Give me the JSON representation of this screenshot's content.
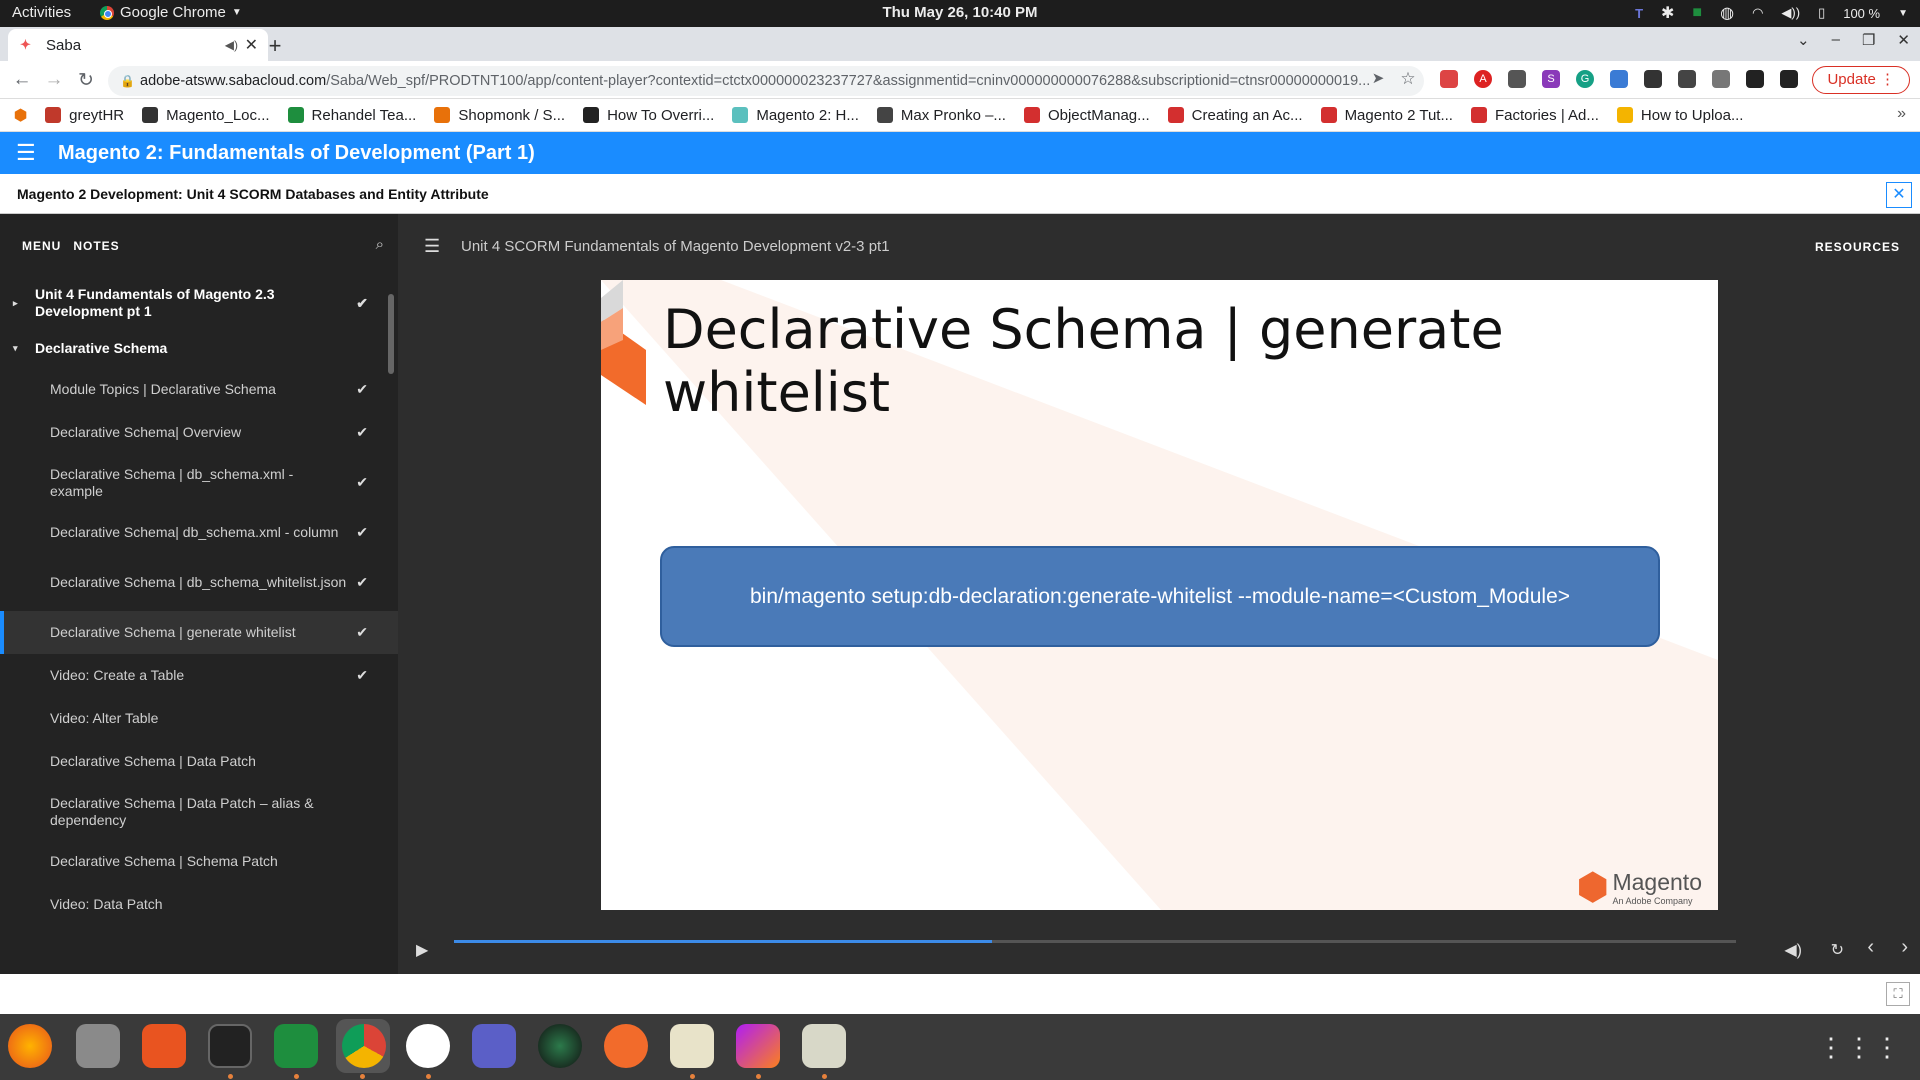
{
  "system": {
    "activities": "Activities",
    "app_name": "Google Chrome",
    "clock": "Thu May 26, 10:40 PM",
    "battery": "100 %"
  },
  "browser": {
    "tab_title": "Saba",
    "url_host": "adobe-atsww.sabacloud.com",
    "url_path": "/Saba/Web_spf/PRODTNT100/app/content-player?contextid=ctctx000000023237727&assignmentid=cninv000000000076288&subscriptionid=ctnsr00000000019...",
    "update_label": "Update",
    "bookmarks": [
      "greytHR",
      "Magento_Loc...",
      "Rehandel Tea...",
      "Shopmonk / S...",
      "How To Overri...",
      "Magento 2: H...",
      "Max Pronko –...",
      "ObjectManag...",
      "Creating an Ac...",
      "Magento 2 Tut...",
      "Factories | Ad...",
      "How to Uploa..."
    ],
    "bookmark_colors": [
      "#c0392b",
      "#333333",
      "#1e8e3e",
      "#e8710a",
      "#222222",
      "#5bc0be",
      "#444444",
      "#d32f2f",
      "#d32f2f",
      "#d32f2f",
      "#d32f2f",
      "#f4b400"
    ]
  },
  "app": {
    "title": "Magento 2: Fundamentals of Development (Part 1)",
    "subtitle": "Magento 2 Development: Unit 4 SCORM Databases and Entity Attribute",
    "accent": "#1a8cff"
  },
  "sidebar": {
    "tab_menu": "MENU",
    "tab_notes": "NOTES",
    "items": [
      {
        "label": "Unit 4 Fundamentals of Magento 2.3 Development pt 1",
        "type": "section",
        "checked": true,
        "arrow": "▸"
      },
      {
        "label": "Declarative Schema",
        "type": "section",
        "checked": false,
        "arrow": "▾"
      },
      {
        "label": "Module Topics | Declarative Schema",
        "type": "child",
        "checked": true
      },
      {
        "label": "Declarative Schema| Overview",
        "type": "child",
        "checked": true
      },
      {
        "label": "Declarative Schema | db_schema.xml - example",
        "type": "child",
        "checked": true
      },
      {
        "label": "Declarative Schema| db_schema.xml - column",
        "type": "child",
        "checked": true
      },
      {
        "label": "Declarative Schema | db_schema_whitelist.json",
        "type": "child",
        "checked": true
      },
      {
        "label": "Declarative Schema | generate whitelist",
        "type": "child",
        "checked": true,
        "active": true
      },
      {
        "label": "Video: Create a Table",
        "type": "child",
        "checked": true
      },
      {
        "label": "Video: Alter Table",
        "type": "child",
        "checked": false
      },
      {
        "label": "Declarative Schema | Data Patch",
        "type": "child",
        "checked": false
      },
      {
        "label": "Declarative Schema | Data Patch – alias & dependency",
        "type": "child",
        "checked": false
      },
      {
        "label": "Declarative Schema | Schema Patch",
        "type": "child",
        "checked": false
      },
      {
        "label": "Video: Data Patch",
        "type": "child",
        "checked": false
      }
    ]
  },
  "content": {
    "module_title": "Unit 4 SCORM Fundamentals of Magento Development v2-3 pt1",
    "resources_label": "RESOURCES",
    "slide_title": "Declarative Schema | generate whitelist",
    "command": "bin/magento setup:db-declaration:generate-whitelist  --module-name=<Custom_Module>",
    "logo_word": "Magento",
    "logo_sub": "An Adobe Company",
    "progress": 0.42
  }
}
